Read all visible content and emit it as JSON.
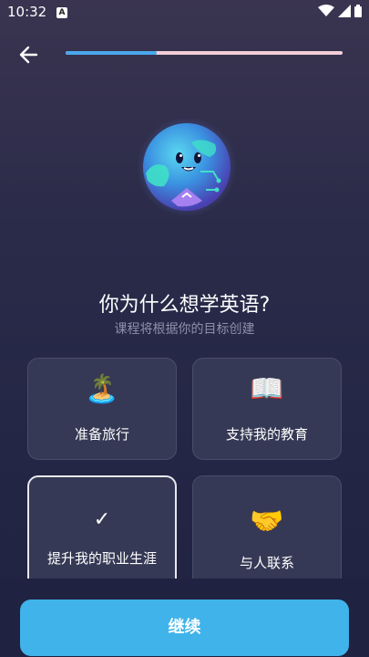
{
  "status": {
    "time": "10:32",
    "notification_badge": "A"
  },
  "header": {
    "progress_percent": 33
  },
  "question": {
    "title": "你为什么想学英语?",
    "subtitle": "课程将根据你的目标创建"
  },
  "options": [
    {
      "emoji": "🏝️",
      "label": "准备旅行",
      "selected": false
    },
    {
      "emoji": "📖",
      "label": "支持我的教育",
      "selected": false
    },
    {
      "check": "✓",
      "label": "提升我的职业生涯",
      "selected": true
    },
    {
      "emoji": "🤝",
      "label": "与人联系",
      "selected": false
    }
  ],
  "footer": {
    "continue_label": "继续"
  },
  "colors": {
    "accent": "#40b3ea",
    "progress_fill": "#4aa8ec",
    "progress_track": "#f3cfd8",
    "card_bg": "#363955"
  }
}
